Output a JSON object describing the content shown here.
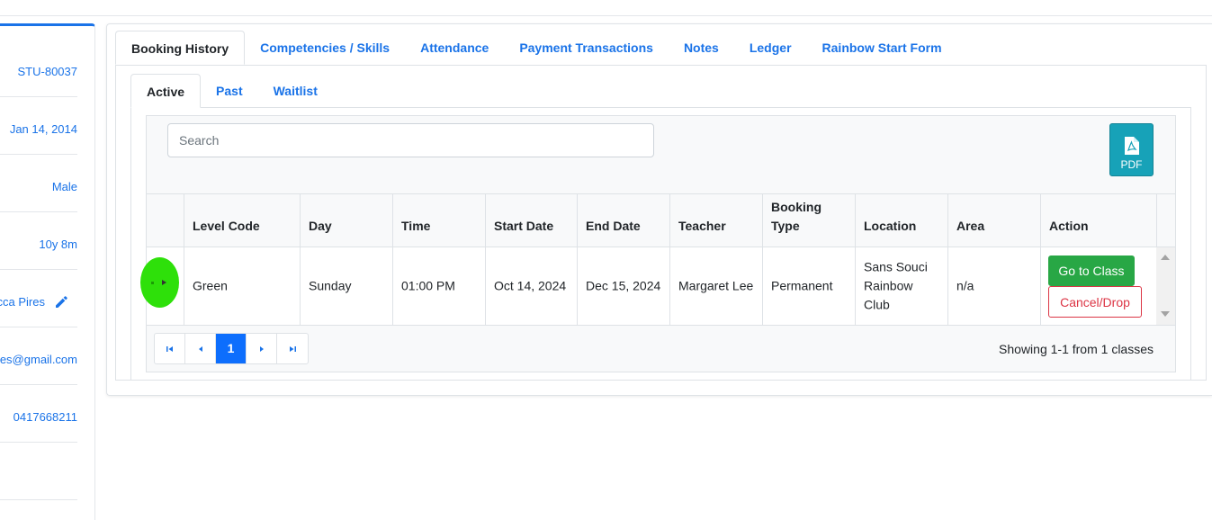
{
  "sidebar": {
    "values": [
      {
        "text": "STU-80037"
      },
      {
        "text": "Jan 14, 2014"
      },
      {
        "text": "Male"
      },
      {
        "text": "10y 8m"
      },
      {
        "text": "cca Pires"
      },
      {
        "text": "res@gmail.com"
      },
      {
        "text": "0417668211"
      },
      {
        "text": ""
      }
    ]
  },
  "tabs": [
    {
      "label": "Booking History"
    },
    {
      "label": "Competencies / Skills"
    },
    {
      "label": "Attendance"
    },
    {
      "label": "Payment Transactions"
    },
    {
      "label": "Notes"
    },
    {
      "label": "Ledger"
    },
    {
      "label": "Rainbow Start Form"
    }
  ],
  "subtabs": [
    {
      "label": "Active"
    },
    {
      "label": "Past"
    },
    {
      "label": "Waitlist"
    }
  ],
  "search": {
    "placeholder": "Search"
  },
  "pdf": {
    "label": "PDF"
  },
  "table": {
    "columns": [
      "Level Code",
      "Day",
      "Time",
      "Start Date",
      "End Date",
      "Teacher",
      "Booking Type",
      "Location",
      "Area",
      "Action"
    ],
    "rows": [
      {
        "level_code": "Green",
        "day": "Sunday",
        "time": "01:00 PM",
        "start_date": "Oct 14, 2024",
        "end_date": "Dec 15, 2024",
        "teacher": "Margaret Lee",
        "booking_type": "Permanent",
        "location": "Sans Souci Rainbow Club",
        "area": "n/a",
        "actions": {
          "go": "Go to Class",
          "cancel": "Cancel/Drop"
        }
      }
    ]
  },
  "pagination": {
    "current_page": "1",
    "summary": "Showing 1-1 from 1 classes"
  },
  "colors": {
    "accent": "#1a73e8",
    "success": "#28a745",
    "danger": "#dc3545",
    "info": "#17a2b8",
    "highlight": "#2ee00a"
  }
}
